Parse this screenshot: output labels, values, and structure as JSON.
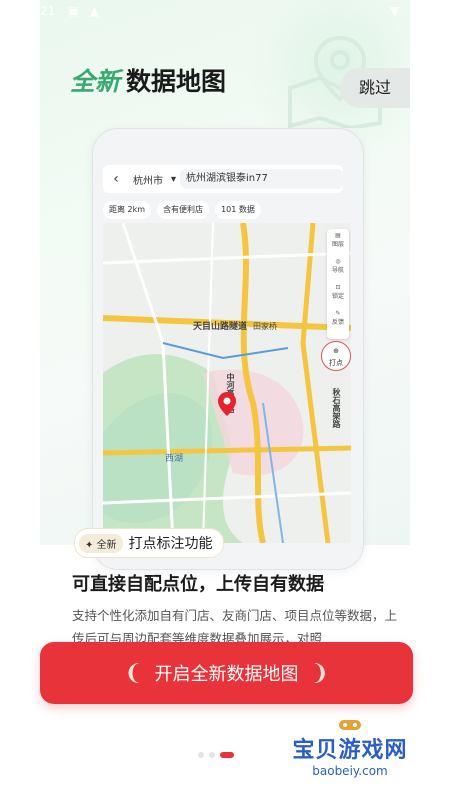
{
  "status_bar": {
    "time": "21"
  },
  "skip_label": "跳过",
  "headline": {
    "accent": "全新",
    "text": "数据地图"
  },
  "phone": {
    "city": "杭州市",
    "search": "杭州湖滨银泰in77",
    "filters": [
      "距离 2km",
      "含有便利店",
      "101 数据"
    ],
    "tools": [
      "图层",
      "导航",
      "锁定",
      "反馈"
    ],
    "pin_label": "打点",
    "map_labels": [
      "天目山路隧道",
      "中河高架路",
      "西湖",
      "秋石高架路",
      "田家桥"
    ]
  },
  "feature_tag": {
    "badge": "全新",
    "label": "打点标注功能"
  },
  "section": {
    "title": "可直接自配点位，上传自有数据",
    "desc": "支持个性化添加自有门店、友商门店、项目点位等数据，上传后可与周边配套等维度数据叠加展示，对照"
  },
  "cta_label": "开启全新数据地图",
  "pager": {
    "count": 3,
    "active": 2
  },
  "watermark": {
    "name": "宝贝游戏网",
    "url": "baobeiy.com"
  },
  "colors": {
    "accent_green": "#3aa871",
    "cta_red": "#e8333a"
  }
}
